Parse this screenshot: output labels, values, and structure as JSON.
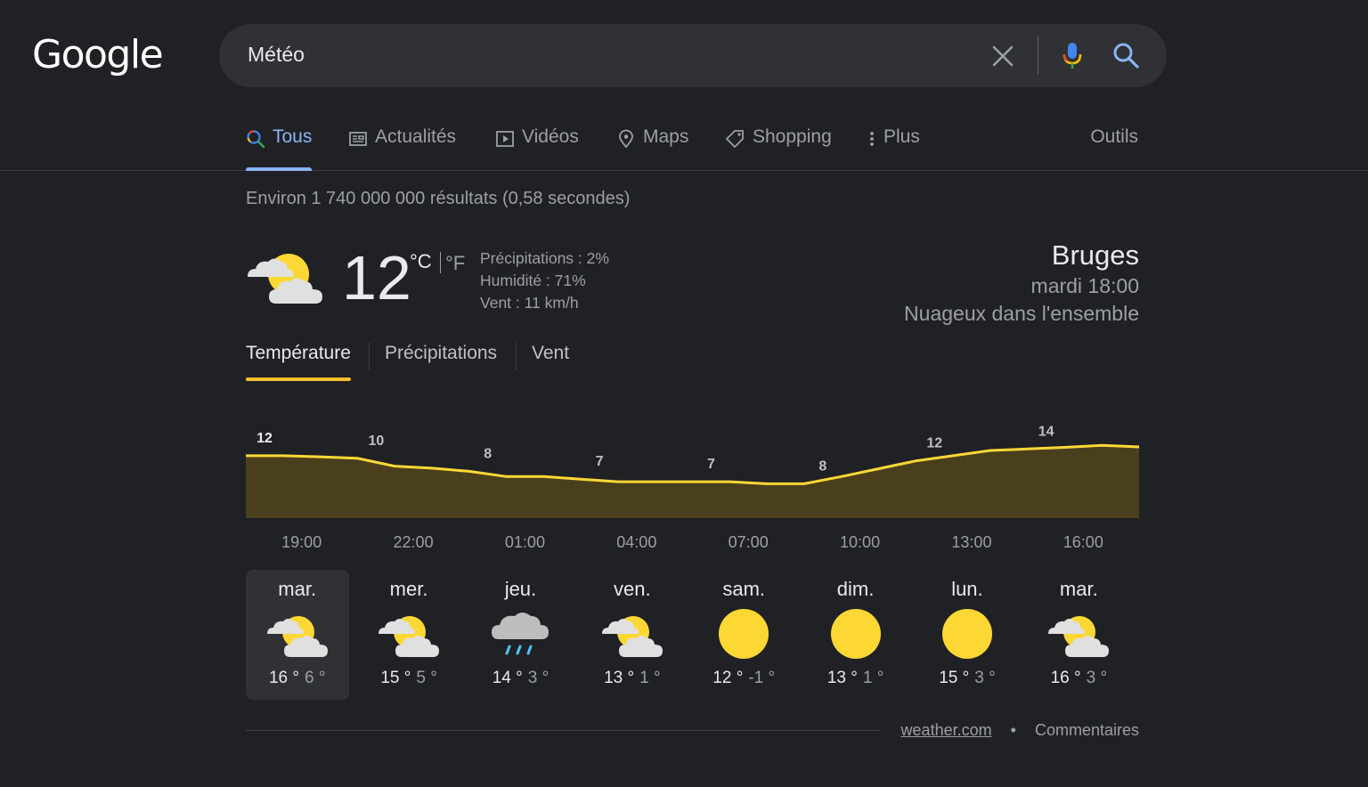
{
  "logo": {
    "text": "Google"
  },
  "search": {
    "query": "Météo"
  },
  "tabs": [
    {
      "label": "Tous",
      "icon": "search-icon",
      "active": true
    },
    {
      "label": "Actualités",
      "icon": "news-icon"
    },
    {
      "label": "Vidéos",
      "icon": "play-icon"
    },
    {
      "label": "Maps",
      "icon": "map-pin-icon"
    },
    {
      "label": "Shopping",
      "icon": "tag-icon"
    },
    {
      "label": "Plus",
      "icon": "more-vert-icon"
    }
  ],
  "tools_label": "Outils",
  "result_stats": "Environ 1 740 000 000 résultats (0,58 secondes)",
  "weather": {
    "temp": "12",
    "unit_c": "°C",
    "unit_f": "°F",
    "precip": "Précipitations : 2%",
    "humidity": "Humidité : 71%",
    "wind": "Vent : 11 km/h",
    "city": "Bruges",
    "time": "mardi 18:00",
    "condition": "Nuageux dans l'ensemble",
    "current_icon": "partly-cloudy-icon",
    "tabs": [
      "Température",
      "Précipitations",
      "Vent"
    ]
  },
  "chart_data": {
    "type": "area",
    "x": [
      "18:00",
      "19:00",
      "20:00",
      "21:00",
      "22:00",
      "23:00",
      "00:00",
      "01:00",
      "02:00",
      "03:00",
      "04:00",
      "05:00",
      "06:00",
      "07:00",
      "08:00",
      "09:00",
      "10:00",
      "11:00",
      "12:00",
      "13:00",
      "14:00",
      "15:00",
      "16:00",
      "17:00",
      "18:00"
    ],
    "values": [
      12,
      12,
      11.8,
      11.5,
      10,
      9.6,
      9,
      8,
      8,
      7.5,
      7,
      7,
      7,
      7,
      6.6,
      6.6,
      8,
      9.5,
      11,
      12,
      13,
      13.3,
      13.6,
      14,
      13.7
    ],
    "labels": [
      {
        "x_index": 0,
        "text": "12"
      },
      {
        "x_index": 3,
        "text": "10"
      },
      {
        "x_index": 6,
        "text": "8"
      },
      {
        "x_index": 9,
        "text": "7"
      },
      {
        "x_index": 12,
        "text": "7"
      },
      {
        "x_index": 15,
        "text": "8"
      },
      {
        "x_index": 18,
        "text": "12"
      },
      {
        "x_index": 21,
        "text": "14"
      }
    ],
    "tick_labels": [
      "19:00",
      "22:00",
      "01:00",
      "04:00",
      "07:00",
      "10:00",
      "13:00",
      "16:00"
    ],
    "ylim": [
      0,
      16
    ],
    "line_color": "#fdd835",
    "fill_color": "#4a3f1d"
  },
  "forecast": [
    {
      "day": "mar.",
      "hi": "16 °",
      "lo": "6 °",
      "icon": "partly-cloudy-icon",
      "selected": true
    },
    {
      "day": "mer.",
      "hi": "15 °",
      "lo": "5 °",
      "icon": "partly-cloudy-icon"
    },
    {
      "day": "jeu.",
      "hi": "14 °",
      "lo": "3 °",
      "icon": "rain-icon"
    },
    {
      "day": "ven.",
      "hi": "13 °",
      "lo": "1 °",
      "icon": "partly-cloudy-icon"
    },
    {
      "day": "sam.",
      "hi": "12 °",
      "lo": "-1 °",
      "icon": "sun-icon"
    },
    {
      "day": "dim.",
      "hi": "13 °",
      "lo": "1 °",
      "icon": "sun-icon"
    },
    {
      "day": "lun.",
      "hi": "15 °",
      "lo": "3 °",
      "icon": "sun-icon"
    },
    {
      "day": "mar.",
      "hi": "16 °",
      "lo": "3 °",
      "icon": "partly-cloudy-icon"
    }
  ],
  "footer": {
    "source": "weather.com",
    "dot": "•",
    "feedback": "Commentaires"
  }
}
